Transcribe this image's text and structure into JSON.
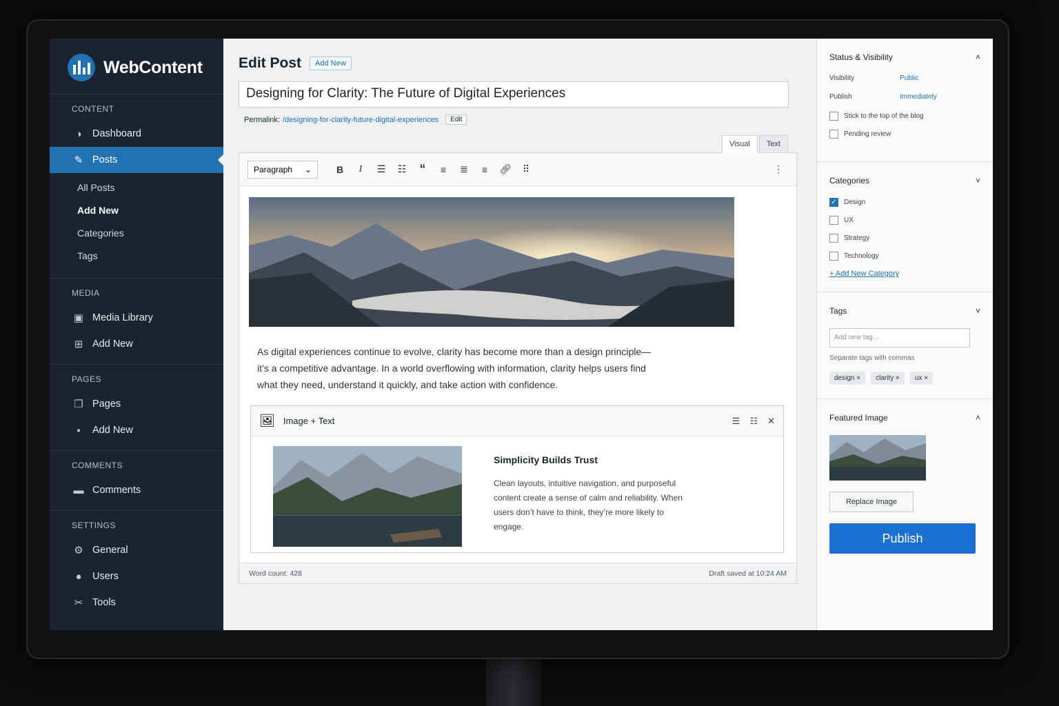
{
  "brand": {
    "name": "WebContent"
  },
  "sidebar": {
    "sections": [
      {
        "heading": "CONTENT",
        "items": [
          {
            "label": "Dashboard",
            "icon": "dashboard-icon"
          },
          {
            "label": "Posts",
            "icon": "pin-icon",
            "active": true
          }
        ],
        "sub": [
          "All Posts",
          "Add New",
          "Categories",
          "Tags"
        ]
      },
      {
        "heading": "MEDIA",
        "items": [
          {
            "label": "Media Library",
            "icon": "media-icon"
          },
          {
            "label": "Add New",
            "icon": "add-media-icon"
          }
        ]
      },
      {
        "heading": "PAGES",
        "items": [
          {
            "label": "Pages",
            "icon": "pages-icon"
          },
          {
            "label": "Add New",
            "icon": "add-page-icon"
          }
        ]
      },
      {
        "heading": "COMMENTS",
        "items": [
          {
            "label": "Comments",
            "icon": "comment-icon"
          }
        ]
      },
      {
        "heading": "SETTINGS",
        "items": [
          {
            "label": "General",
            "icon": "gear-icon"
          },
          {
            "label": "Users",
            "icon": "user-icon"
          },
          {
            "label": "Tools",
            "icon": "wrench-icon"
          }
        ]
      }
    ]
  },
  "main": {
    "page_title": "Edit Post",
    "add_new": "Add New",
    "post_title": "Designing for Clarity: The Future of Digital Experiences",
    "permalink_label": "Permalink:",
    "permalink_url": "/designing-for-clarity-future-digital-experiences",
    "permalink_edit": "Edit",
    "tabs": [
      "Visual",
      "Text"
    ],
    "format": "Paragraph",
    "paragraph": "As digital experiences continue to evolve, clarity has become more than a design principle—it’s a competitive advantage. In a world overflowing with information, clarity helps users find what they need, understand it quickly, and take action with confidence.",
    "block": {
      "label": "Image + Text",
      "heading": "Simplicity Builds Trust",
      "text": "Clean layouts, intuitive navigation, and purposeful content create a sense of calm and reliability. When users don’t have to think, they’re more likely to engage."
    },
    "word_count": "Word count: 428",
    "draft_saved": "Draft saved at 10:24 AM"
  },
  "panel": {
    "status": {
      "title": "Status & Visibility",
      "visibility_label": "Visibility",
      "visibility_value": "Public",
      "publish_label": "Publish",
      "publish_value": "Immediately",
      "stick": "Stick to the top of the blog",
      "pending": "Pending review"
    },
    "categories": {
      "title": "Categories",
      "items": [
        {
          "label": "Design",
          "checked": true
        },
        {
          "label": "UX",
          "checked": false
        },
        {
          "label": "Strategy",
          "checked": false
        },
        {
          "label": "Technology",
          "checked": false
        }
      ],
      "add": "+ Add New Category"
    },
    "tags": {
      "title": "Tags",
      "placeholder": "Add new tag...",
      "hint": "Separate tags with commas",
      "items": [
        "design",
        "clarity",
        "ux"
      ]
    },
    "featured": {
      "title": "Featured Image",
      "replace": "Replace Image"
    },
    "publish": "Publish"
  },
  "colors": {
    "accent": "#2271b1",
    "publish": "#1a6fd0",
    "sidebar": "#1b2330"
  }
}
